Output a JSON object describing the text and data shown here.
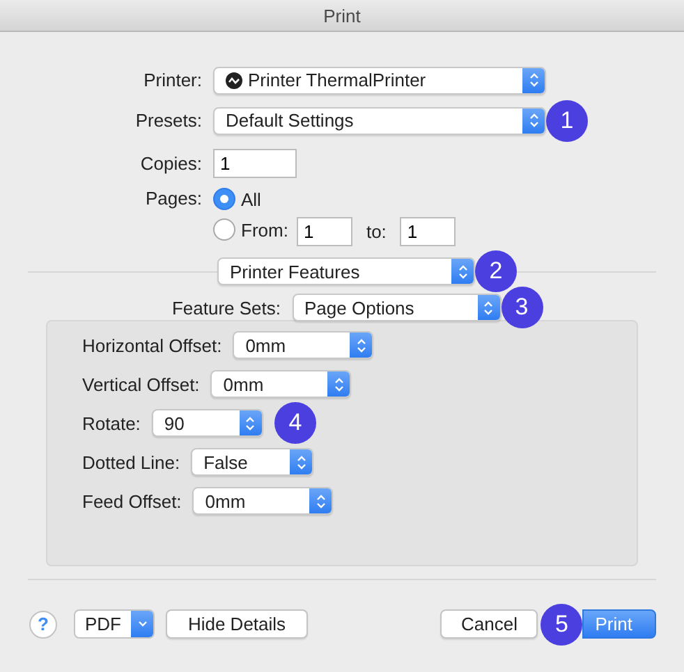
{
  "window": {
    "title": "Print"
  },
  "printer": {
    "label": "Printer:",
    "value": "Printer ThermalPrinter"
  },
  "presets": {
    "label": "Presets:",
    "value": "Default Settings",
    "callout": "1"
  },
  "copies": {
    "label": "Copies:",
    "value": "1"
  },
  "pages": {
    "label": "Pages:",
    "options": [
      {
        "label": "All",
        "selected": true
      },
      {
        "label": "From:",
        "selected": false
      }
    ],
    "from": "1",
    "to_label": "to:",
    "to": "1"
  },
  "section": {
    "value": "Printer Features",
    "callout": "2"
  },
  "feature_sets": {
    "label": "Feature Sets:",
    "value": "Page Options",
    "callout": "3"
  },
  "options": [
    {
      "label": "Horizontal Offset:",
      "value": "0mm"
    },
    {
      "label": "Vertical Offset:",
      "value": "0mm"
    },
    {
      "label": "Rotate:",
      "value": "90",
      "callout": "4"
    },
    {
      "label": "Dotted Line:",
      "value": "False"
    },
    {
      "label": "Feed Offset:",
      "value": "0mm"
    }
  ],
  "footer": {
    "help": "?",
    "pdf": "PDF",
    "hide_details": "Hide Details",
    "cancel": "Cancel",
    "print": "Print",
    "callout": "5"
  }
}
